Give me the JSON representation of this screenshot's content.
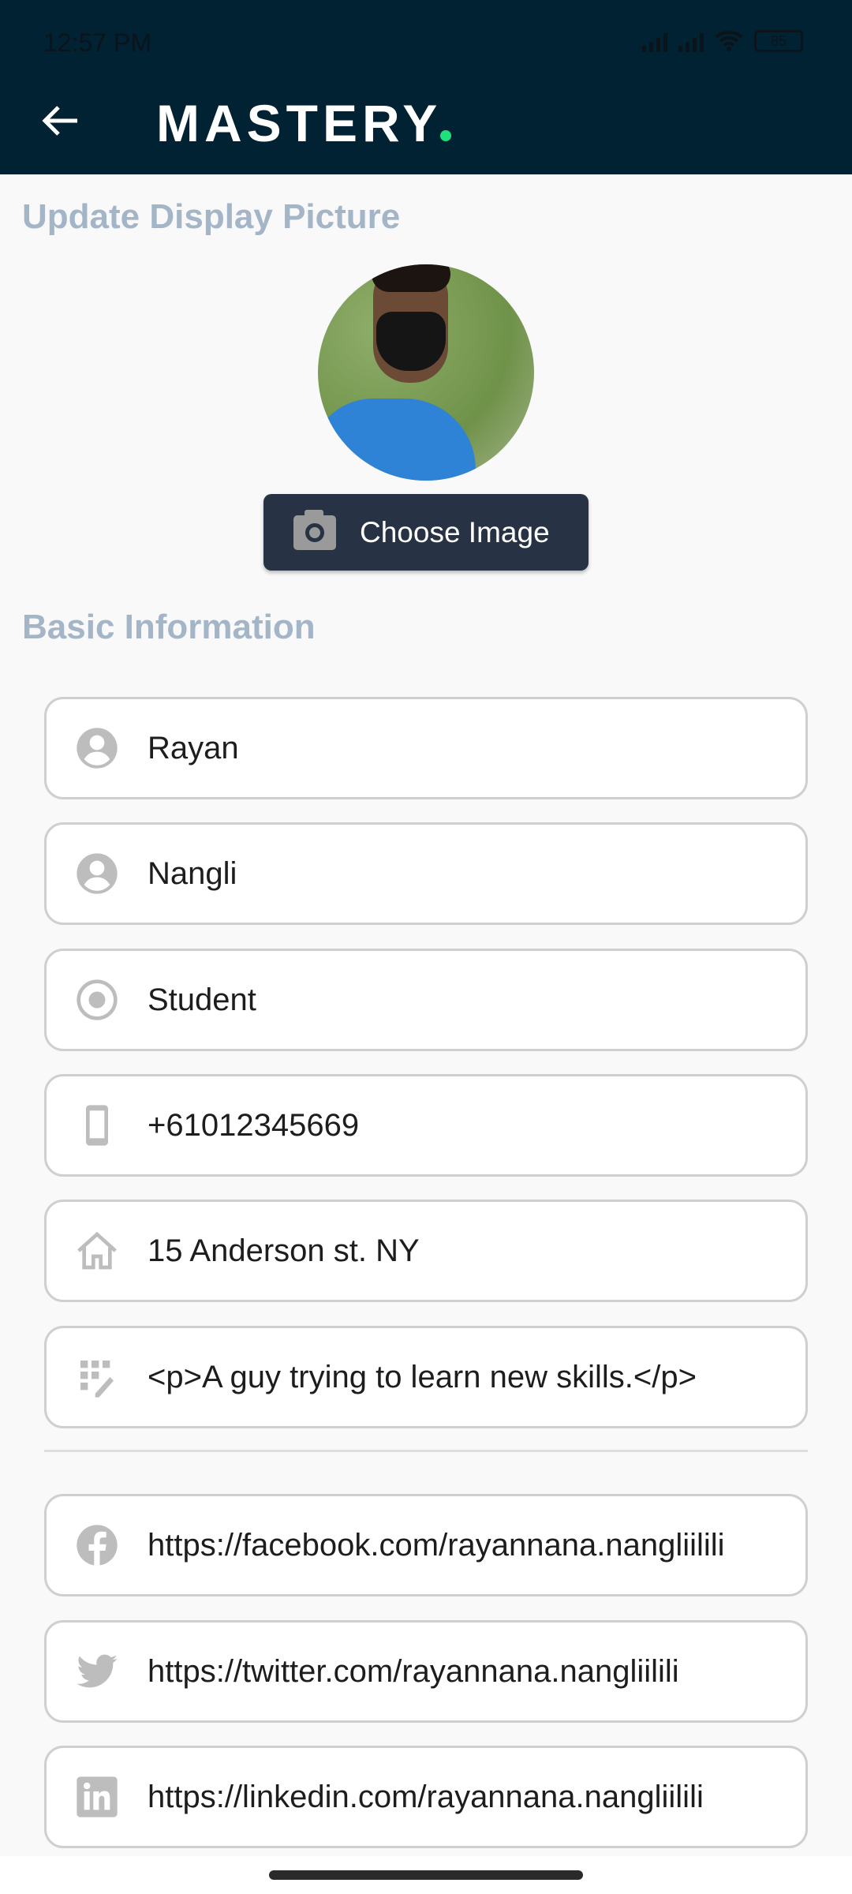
{
  "status_bar": {
    "time": "12:57 PM",
    "battery": "85"
  },
  "app_bar": {
    "logo": "MASTERY",
    "accent_color": "#1ee07d",
    "background": "#012233"
  },
  "display_picture": {
    "title": "Update Display Picture",
    "choose_button": "Choose Image"
  },
  "basic_info": {
    "title": "Basic Information",
    "fields": [
      {
        "icon": "person-icon",
        "value": "Rayan"
      },
      {
        "icon": "person-icon",
        "value": "Nangli"
      },
      {
        "icon": "radio-target-icon",
        "value": "Student"
      },
      {
        "icon": "phone-icon",
        "value": "+61012345669"
      },
      {
        "icon": "home-icon",
        "value": "15 Anderson st. NY"
      },
      {
        "icon": "edit-note-icon",
        "value": "<p>A guy trying to learn new skills.</p>"
      }
    ]
  },
  "social": [
    {
      "icon": "facebook-icon",
      "value": "https://facebook.com/rayannana.nangliilili"
    },
    {
      "icon": "twitter-icon",
      "value": "https://twitter.com/rayannana.nangliilili"
    },
    {
      "icon": "linkedin-icon",
      "value": "https://linkedin.com/rayannana.nangliilili"
    }
  ]
}
